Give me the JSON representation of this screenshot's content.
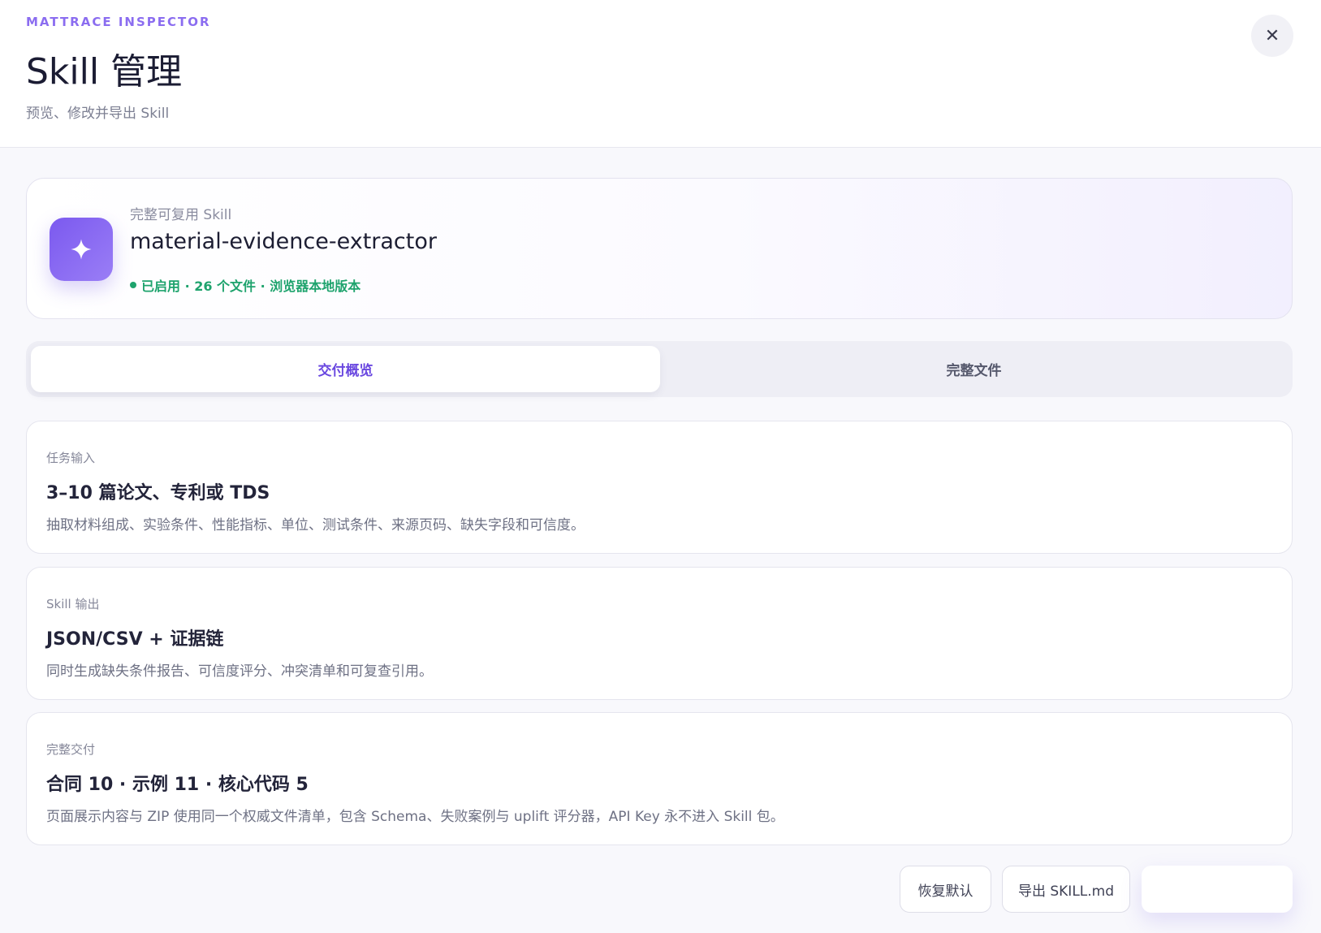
{
  "header": {
    "eyebrow": "MATTRACE INSPECTOR",
    "title": "Skill 管理",
    "subtitle": "预览、修改并导出 Skill",
    "close_glyph": "✕"
  },
  "skill": {
    "kicker": "完整可复用 Skill",
    "name": "material-evidence-extractor",
    "status": "已启用 · 26 个文件 · 浏览器本地版本",
    "icon": "sparkle-icon",
    "accent_color": "#7b59ef",
    "status_color": "#1ea36d"
  },
  "tabs": [
    {
      "label": "交付概览",
      "active": true
    },
    {
      "label": "完整文件",
      "active": false
    }
  ],
  "cards": [
    {
      "label": "任务输入",
      "title": "3–10 篇论文、专利或 TDS",
      "desc": "抽取材料组成、实验条件、性能指标、单位、测试条件、来源页码、缺失字段和可信度。"
    },
    {
      "label": "Skill 输出",
      "title": "JSON/CSV + 证据链",
      "desc": "同时生成缺失条件报告、可信度评分、冲突清单和可复查引用。"
    },
    {
      "label": "完整交付",
      "title": "合同 10 · 示例 11 · 核心代码 5",
      "desc": "页面展示内容与 ZIP 使用同一个权威文件清单，包含 Schema、失败案例与 uplift 评分器，API Key 永不进入 Skill 包。"
    }
  ],
  "footer": {
    "reset_label": "恢复默认",
    "export_label": "导出 SKILL.md",
    "primary_label": ""
  }
}
